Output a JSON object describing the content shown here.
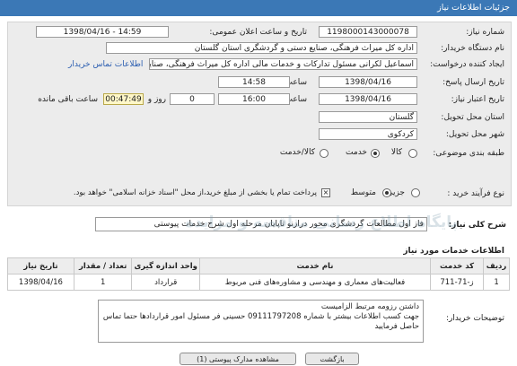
{
  "header": {
    "title": "جزئیات اطلاعات نیاز"
  },
  "form": {
    "need_number_label": "شماره نیاز:",
    "need_number": "1198000143000078",
    "announce_label": "تاریخ و ساعت اعلان عمومی:",
    "announce_value": "1398/04/16 - 14:59",
    "buyer_label": "نام دستگاه خریدار:",
    "buyer_value": "اداره کل میراث فرهنگی، صنایع دستی و گردشگری استان گلستان",
    "creator_label": "ایجاد کننده درخواست:",
    "creator_value": "اسماعیل لکرانی مسئول تدارکات و خدمات مالی اداره کل میراث فرهنگی، صنایع",
    "contact_link": "اطلاعات تماس خریدار",
    "reply_deadline_label": "تاریخ ارسال پاسخ:",
    "reply_date": "1398/04/16",
    "reply_time_label": "ساعت",
    "reply_time": "14:58",
    "validity_label": "تاریخ اعتبار نیاز:",
    "validity_date": "1398/04/16",
    "validity_time_label": "ساعت",
    "validity_time": "16:00",
    "days_value": "0",
    "days_label": "روز و",
    "remaining_time": "00:47:49",
    "remaining_label": "ساعت باقی مانده",
    "province_label": "استان محل تحویل:",
    "province_value": "گلستان",
    "city_label": "شهر محل تحویل:",
    "city_value": "کردکوی",
    "category_label": "طبقه بندی موضوعی:",
    "category_options": [
      "کالا",
      "خدمت",
      "کالا/خدمت"
    ],
    "category_selected": "خدمت",
    "process_label": "نوع فرآیند خرید :",
    "process_options": [
      "جزیی",
      "متوسط"
    ],
    "process_selected": "متوسط",
    "treasury_note": "پرداخت تمام یا بخشی از مبلغ خرید،از محل \"اسناد خزانه اسلامی\" خواهد بود."
  },
  "summary": {
    "label": "شرح کلی نیاز:",
    "value": "فاز اول مطالعات گردشگری  محور درازنو تاپایان مرحله اول شرح خدمات پیوستی"
  },
  "services": {
    "section_title": "اطلاعات خدمات مورد نیاز",
    "columns": [
      "ردیف",
      "کد خدمت",
      "نام خدمت",
      "واحد اندازه گیری",
      "تعداد / مقدار",
      "تاریخ نیاز"
    ],
    "rows": [
      [
        "1",
        "ز-71-711",
        "فعالیت‌های معماری و مهندسی و مشاوره‌های فنی مربوط",
        "قرارداد",
        "1",
        "1398/04/16"
      ]
    ]
  },
  "buyer_notes": {
    "label": "توضیحات خریدار:",
    "lines": [
      "داشتن رزومه مرتبط الزامیست",
      "جهت کسب اطلاعات بیشتر با شماره 09111797208 حسینی فر مسئول امور قراردادها حتما تماس",
      "حاصل فرمایید"
    ]
  },
  "watermark": "پایگاه اطلاع رسانی مناقصه و مزایده",
  "footer": {
    "attachments_button": "مشاهده مدارک پیوستی (1)",
    "back_button": "بازگشت"
  }
}
